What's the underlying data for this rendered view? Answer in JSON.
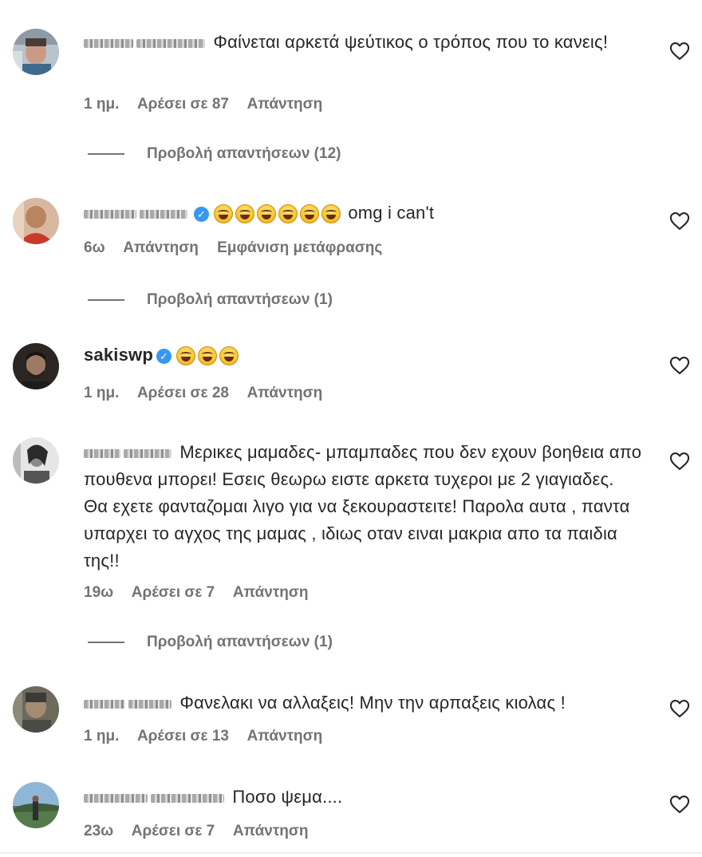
{
  "comments": [
    {
      "text": "Φαίνεται αρκετά ψεύτικος ο τρόπος που το κανεις!",
      "meta": {
        "time": "1 ημ.",
        "likes": "Αρέσει σε 87",
        "reply": "Απάντηση"
      },
      "replies": "Προβολή απαντήσεων (12)"
    },
    {
      "text": "omg i can't",
      "meta": {
        "time": "6ω",
        "reply": "Απάντηση",
        "translate": "Εμφάνιση μετάφρασης"
      },
      "replies": "Προβολή απαντήσεων (1)"
    },
    {
      "username": "sakiswp",
      "meta": {
        "time": "1 ημ.",
        "likes": "Αρέσει σε 28",
        "reply": "Απάντηση"
      }
    },
    {
      "text": "Μερικες μαμαδες- μπαμπαδες που δεν εχουν βοηθεια απο πουθενα μπορει! Εσεις θεωρω ειστε αρκετα τυχεροι με 2 γιαγιαδες. Θα εχετε φανταζομαι λιγο για να ξεκουραστειτε! Παρολα αυτα , παντα υπαρχει το αγχος της μαμας , ιδιως οταν ειναι μακρια απο τα παιδια της!!",
      "meta": {
        "time": "19ω",
        "likes": "Αρέσει σε 7",
        "reply": "Απάντηση"
      },
      "replies": "Προβολή απαντήσεων (1)"
    },
    {
      "text": "Φανελακι να αλλαξεις! Μην την αρπαξεις κιολας !",
      "meta": {
        "time": "1 ημ.",
        "likes": "Αρέσει σε 13",
        "reply": "Απάντηση"
      }
    },
    {
      "text": "Ποσο ψεμα....",
      "meta": {
        "time": "23ω",
        "likes": "Αρέσει σε 7",
        "reply": "Απάντηση"
      }
    }
  ],
  "icons": {
    "heart": "heart-icon",
    "verified": "verified-badge-icon",
    "emoji": "face-with-tears-of-joy-emoji"
  },
  "colors": {
    "text": "#262626",
    "muted": "#737373",
    "verified": "#3897f0"
  }
}
